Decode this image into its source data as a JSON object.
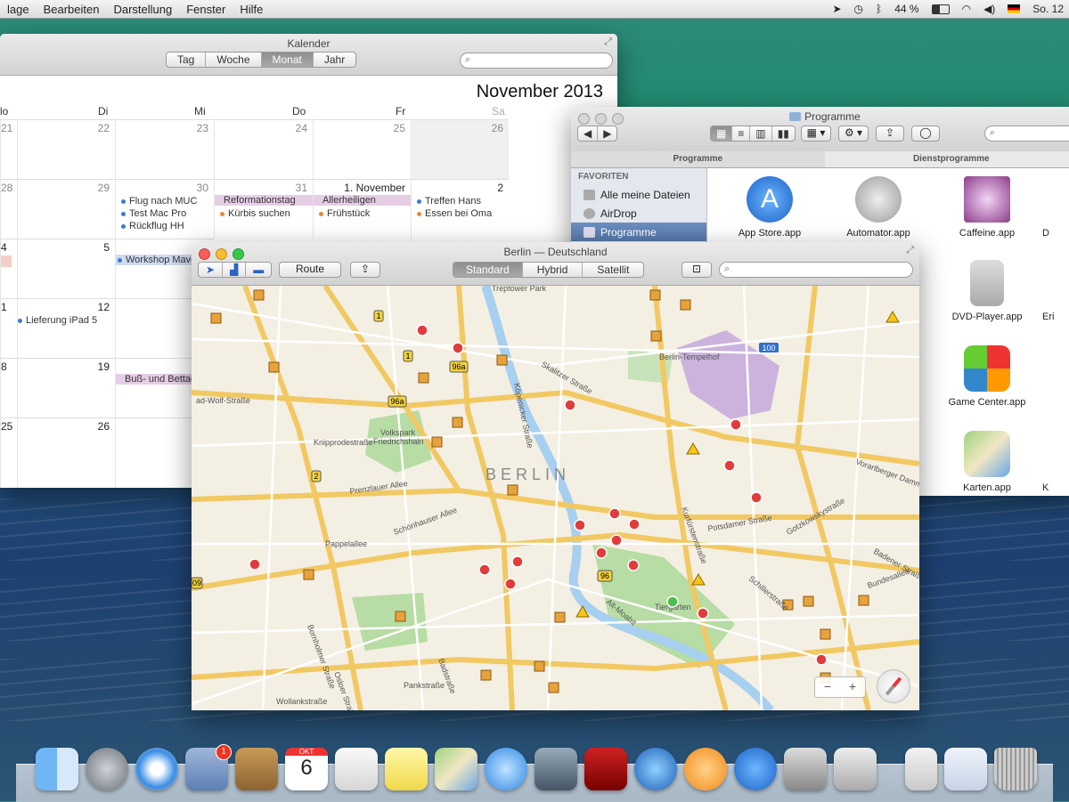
{
  "menubar": {
    "items": [
      "lage",
      "Bearbeiten",
      "Darstellung",
      "Fenster",
      "Hilfe"
    ],
    "battery": "44 %",
    "clock": "So. 12"
  },
  "calendar": {
    "title": "Kalender",
    "views": [
      "Tag",
      "Woche",
      "Monat",
      "Jahr"
    ],
    "active_view": "Monat",
    "month": "November 2013",
    "weekdays": [
      "lo",
      "Di",
      "Mi",
      "Do",
      "Fr",
      "Sa"
    ],
    "rows": [
      [
        "21",
        "22",
        "23",
        "24",
        "25",
        "26"
      ],
      [
        "28",
        "29",
        "30",
        "31",
        "1. November",
        "2"
      ],
      [
        "4",
        "5",
        "",
        "",
        "",
        ""
      ],
      [
        "1",
        "12",
        "",
        "",
        "",
        ""
      ],
      [
        "8",
        "19",
        "",
        "",
        "",
        ""
      ],
      [
        "25",
        "26",
        "",
        "",
        "",
        ""
      ]
    ],
    "events": {
      "flug": "Flug nach MUC",
      "test": "Test Mac Pro",
      "rueck": "Rückflug HH",
      "reformation": "Reformationstag",
      "kuerbis": "Kürbis suchen",
      "allerheiligen": "Allerheiligen",
      "fruehstueck": "Frühstück",
      "hans": "Treffen Hans",
      "oma": "Essen bei Oma",
      "workshop": "Workshop Maver",
      "ipad": "Lieferung iPad 5",
      "buss": "Buß- und Bettag"
    }
  },
  "finder": {
    "title": "Programme",
    "tabs": [
      "Programme",
      "Dienstprogramme"
    ],
    "sidebar_header": "FAVORITEN",
    "sidebar": [
      "Alle meine Dateien",
      "AirDrop",
      "Programme"
    ],
    "apps": [
      {
        "label": "App Store.app"
      },
      {
        "label": "Automator.app"
      },
      {
        "label": "Caffeine.app"
      },
      {
        "label": "D"
      },
      {
        "label": "DVD-Player.app"
      },
      {
        "label": "Eri"
      },
      {
        "label": "Game Center.app"
      },
      {
        "label": "Karten.app"
      },
      {
        "label": "K"
      }
    ]
  },
  "maps": {
    "title": "Berlin — Deutschland",
    "route_label": "Route",
    "modes": [
      "Standard",
      "Hybrid",
      "Satellit"
    ],
    "active_mode": "Standard",
    "labels": {
      "city": "BERLIN",
      "treptower": "Treptower Park",
      "tempelhof": "Berlin-Tempelhof",
      "volkspark": "Volkspark",
      "friedrichshain": "Friedrichshain",
      "tiergarten": "Tiergarten",
      "prenzlauer": "Prenzlauer Allee",
      "schoenhauser": "Schönhauser Allee",
      "knipro": "Knipprodestraße",
      "pappel": "Pappelallee",
      "potsdamer": "Potsdamer Straße",
      "skalitzer": "Skalitzer Straße",
      "koepenicker": "Köpenicker Straße",
      "kirchpietsch": "Kurfürstenstraße",
      "wolf": "ad-Wolf-Straße",
      "vorarlberger": "Vorarlberger Damm",
      "altmoabit": "Alt-Moabit",
      "bornholmer": "Bornholmer Straße",
      "ossee": "Osloer Straße",
      "wollank": "Wollankstraße",
      "pank": "Pankstraße",
      "bad": "Badstraße",
      "gotzkowsky": "Gotzkowskystraße",
      "bedener": "Badener Straße",
      "bundesallee": "Bundesallee",
      "schiffer": "Schillerstraße"
    },
    "shields": {
      "s100": "100",
      "s96a": "96a",
      "s96a2": "96a",
      "s96": "96",
      "s1": "1",
      "s1b": "1",
      "s2": "2",
      "s09": "09"
    }
  },
  "dock": {
    "mail_badge": "1",
    "calendar_month": "OKT",
    "calendar_day": "6"
  }
}
